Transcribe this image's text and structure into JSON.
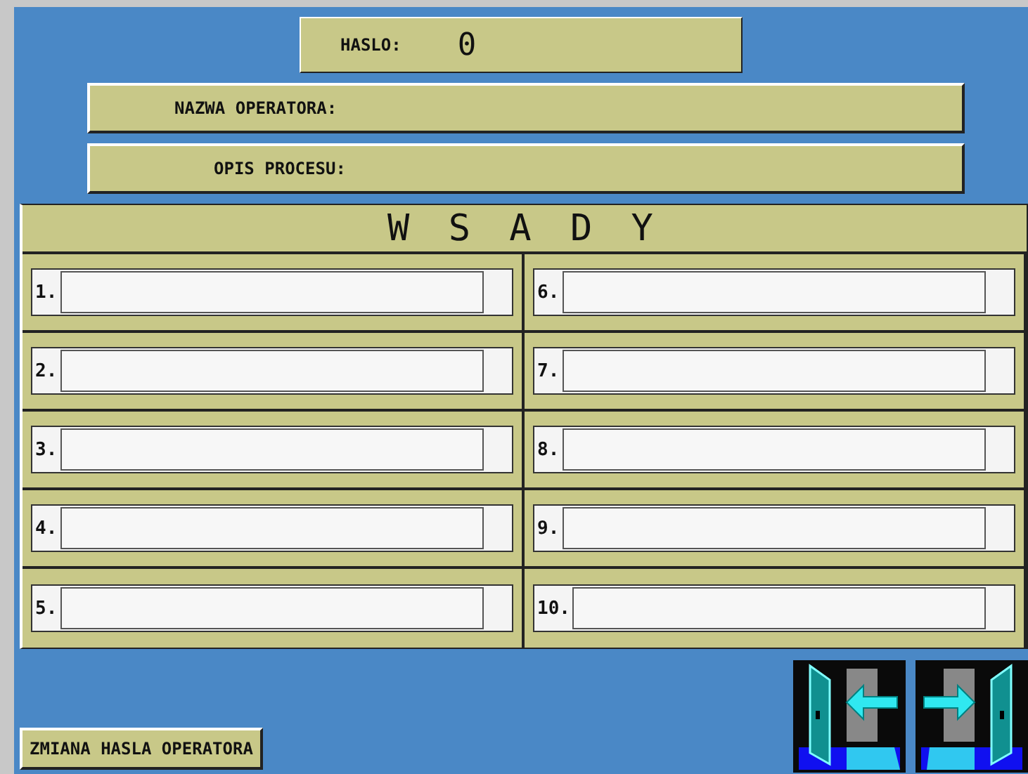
{
  "password": {
    "label": "HASLO:",
    "value": "0"
  },
  "operator": {
    "label": "NAZWA OPERATORA:"
  },
  "process": {
    "label": "OPIS PROCESU:"
  },
  "batches": {
    "title": "W S A D Y",
    "slots": [
      {
        "label": "1."
      },
      {
        "label": "2."
      },
      {
        "label": "3."
      },
      {
        "label": "4."
      },
      {
        "label": "5."
      },
      {
        "label": "6."
      },
      {
        "label": "7."
      },
      {
        "label": "8."
      },
      {
        "label": "9."
      },
      {
        "label": "10."
      }
    ]
  },
  "change_password_button": "ZMIANA HASLA OPERATORA"
}
